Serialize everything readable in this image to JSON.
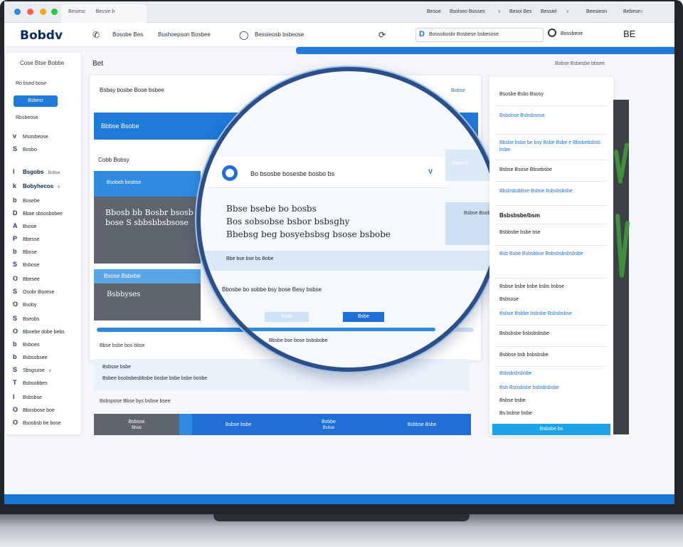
{
  "browser": {
    "tab": "Besiesc",
    "tab_extra": "Bessie b",
    "links": [
      "Besoe",
      "Bsolseo Bosses",
      "Besoi Bes",
      "Bessiel",
      "Beesieon",
      "Bebese"
    ],
    "separators": [
      "v",
      "v",
      "v"
    ]
  },
  "header": {
    "logo": "Bobdv",
    "nav": [
      {
        "icon": "&",
        "label": "Bosobe Bes"
      },
      {
        "icon": "",
        "label": "Bushoepson Bosbee"
      },
      {
        "icon": "",
        "label": "Bessieosb bsbeose"
      },
      {
        "icon": "",
        "label": ""
      }
    ],
    "search_label": "D",
    "search_text": "Bossobosbr Bosbese bsbesose",
    "user": "Bossbeoe",
    "menu": "BE"
  },
  "sidebar": {
    "title": "Cose Btse Bobbe",
    "subtitle": "Ro bsed bose",
    "button": "Bsbesr",
    "label": "Rbsbeose",
    "items": [
      {
        "icon": "v",
        "label": "Msosbeose",
        "aux": ""
      },
      {
        "icon": "S",
        "label": "Bosbo",
        "aux": ""
      },
      {
        "icon": "l",
        "label": "Bsgobs",
        "aux": "Bobse",
        "bold": true
      },
      {
        "icon": "k",
        "label": "Bobyhecos",
        "aux": "v",
        "bold": true
      },
      {
        "icon": "b",
        "label": "Bosebe",
        "aux": ""
      },
      {
        "icon": "D",
        "label": "Bbae sbsosbobee",
        "aux": ""
      },
      {
        "icon": "A",
        "label": "Bsose",
        "aux": ""
      },
      {
        "icon": "P",
        "label": "Bbesse",
        "aux": ""
      },
      {
        "icon": "b",
        "label": "Bbose",
        "aux": ""
      },
      {
        "icon": "S",
        "label": "Bsbose",
        "aux": ""
      },
      {
        "icon": "O",
        "label": "Bbesee",
        "aux": ""
      },
      {
        "icon": "S",
        "label": "Osobr Bsoese",
        "aux": ""
      },
      {
        "icon": "O",
        "label": "Bsoby",
        "aux": ""
      },
      {
        "icon": "S",
        "label": "Bseobs",
        "aux": ""
      },
      {
        "icon": "O",
        "label": "Bboebe dobe bebs",
        "aux": ""
      },
      {
        "icon": "b",
        "label": "Bsboes",
        "aux": ""
      },
      {
        "icon": "b",
        "label": "Bsbsobsee",
        "aux": ""
      },
      {
        "icon": "S",
        "label": "Sbsgsose",
        "aux": "v"
      },
      {
        "icon": "T",
        "label": "Bsbsobbes",
        "aux": ""
      },
      {
        "icon": "I",
        "label": "Bsbsbse",
        "aux": ""
      },
      {
        "icon": "O",
        "label": "Bbosbose boe",
        "aux": ""
      },
      {
        "icon": "O",
        "label": "Bsosbsb be bose",
        "aux": ""
      }
    ]
  },
  "main": {
    "heading": "Bet",
    "top_right": "Bobse Bsbesbe bbsee",
    "card_title": "Bsbay bosbe Bose bsbee",
    "card_link": "Bobse",
    "blue_bar": "Bbbse Bsobe",
    "section_label": "Cobb Bobsy",
    "left_panel_top": "Bsobeb bosbse",
    "left_panel_big": "Bbosb bb Bosbr bsosb bose S sbbsbbsbsose",
    "left_panel2_top": "Bsose Bsbebe",
    "left_panel2_text": "Bsbbyses",
    "progress": 0.88,
    "footnote": "Bbse bsbe bos bbse"
  },
  "magnifier": {
    "card_title": "Bo bsosbe bosesbe bosbo bs",
    "card_chevron": "V",
    "side_box": "Bsobse",
    "side_box2": "Bsbse Bsobe",
    "lines": [
      "Bbse bsebe bo bosbs",
      "Bos sobsobse bsbor bsbsghy",
      "Bbebsg beg bosyebsbsg bsose bsbobe"
    ],
    "band": "Bbe bse bse bs Bobe",
    "note": "Bbosbe bo sobbe bsy bose Besy bsbse",
    "btn_light": "Bsse",
    "btn_primary": "Bsbe",
    "footer": "Bbsbe bse bose bsbsbobe"
  },
  "table": {
    "title": "Bsbsse bsbe",
    "row": "Bsbee bsobsbesbbsbe bosbe bsbe bsbe bosbe",
    "caption": "Bobspose Bbse bys bsbse bsee"
  },
  "bottom_bar": [
    {
      "label": "Bsbsse",
      "sub": "Bbsb",
      "color": "#5e656f"
    },
    {
      "label": "",
      "sub": "",
      "color": "#2f8ae0"
    },
    {
      "label": "Bsbse bsbe",
      "sub": "",
      "color": "#1f6fd6"
    },
    {
      "label": "Bsbbe",
      "sub": "Bsbse",
      "color": "#1f6fd6"
    },
    {
      "label": "Bsbbse Bsbe",
      "sub": "",
      "color": "#1f6fd6"
    }
  ],
  "right_panel": {
    "items": [
      {
        "text": "Bsosbe Bsbs Bsosy",
        "style": "dark"
      },
      {
        "text": "Bsbobse Bsbsbsose",
        "style": "blue"
      },
      {
        "text": "Bbsbe bsbe be bsy Bsbe Bsbe e Bbobebsbsb bsbe",
        "style": "blue"
      },
      {
        "text": "Bsbse Bsose Bbsebsbe",
        "style": "dark"
      },
      {
        "text": "Bbsbsbsbbse Bsbse bsbsbsbsbe",
        "style": "blue"
      },
      {
        "text": "Bsbsbsbe/bsm",
        "style": "bold"
      },
      {
        "text": "Bsbbsbe bsbe bse",
        "style": "dark"
      },
      {
        "text": "Bsb Bsbe Bsbsbbse Bsbsbsbsbsbsbe",
        "style": "blue"
      },
      {
        "text": "Bsbse bsbe bsbe bsbs bsbse",
        "style": "dark"
      },
      {
        "text": "Bsbsose",
        "style": "dark"
      },
      {
        "text": "Bsbse Bsbbe bsbsbe Bsbsbsbse",
        "style": "blue"
      },
      {
        "text": "Bsbsbsbe bsbsbsbsbe",
        "style": "dark"
      },
      {
        "text": "Bsbbse bsb bsbsbsbe",
        "style": "dark"
      },
      {
        "text": "Bsbsbsbsbsbe",
        "style": "blue"
      },
      {
        "text": "Bsb Bsbsbsbe bsbsbsbsbe",
        "style": "blue"
      },
      {
        "text": "Bsbse bsbe",
        "style": "dark"
      },
      {
        "text": "Bs bsbse bsbe",
        "style": "dark"
      }
    ],
    "button": "Bsbsbe bs"
  },
  "colors": {
    "accent": "#1f7ad8",
    "dark_panel": "#5e656f",
    "sidebar_bg": "#ffffff"
  }
}
